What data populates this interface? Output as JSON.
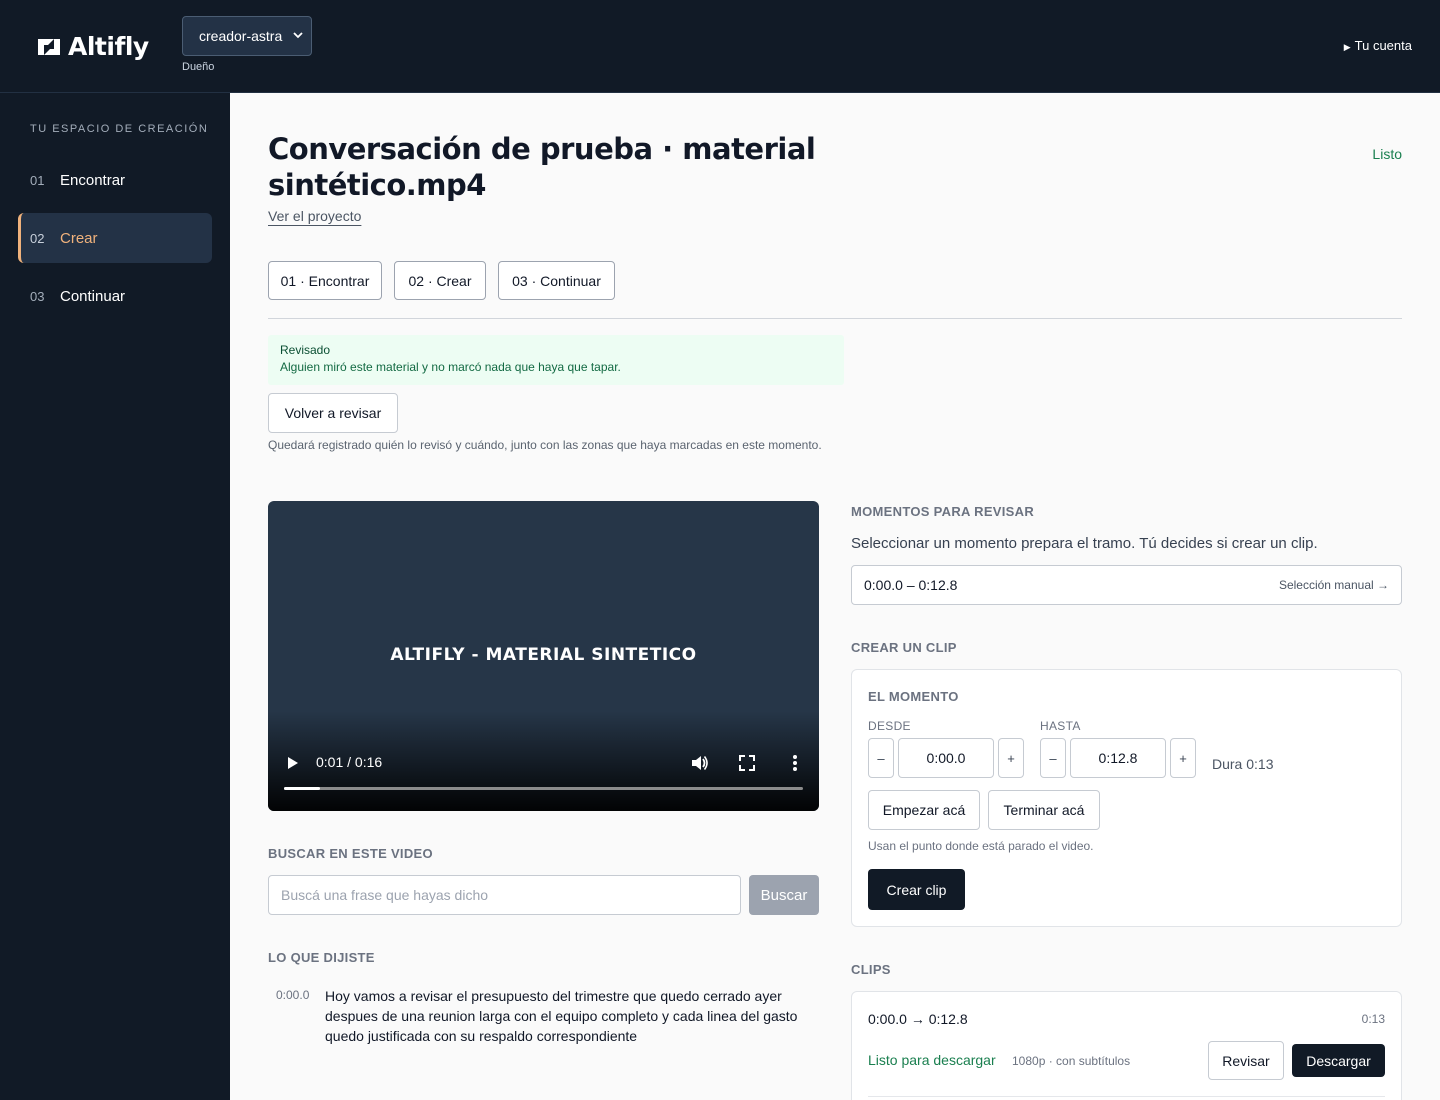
{
  "header": {
    "logo_text": "Altifly",
    "workspace": "creador-astra",
    "role": "Dueño",
    "account": "Tu cuenta"
  },
  "sidebar": {
    "title": "TU ESPACIO DE CREACIÓN",
    "items": [
      {
        "num": "01",
        "label": "Encontrar"
      },
      {
        "num": "02",
        "label": "Crear",
        "active": true
      },
      {
        "num": "03",
        "label": "Continuar"
      }
    ]
  },
  "project": {
    "title": "Conversación de prueba · material sintético.mp4",
    "link": "Ver el proyecto",
    "status": "Listo"
  },
  "steps": [
    "01 · Encontrar",
    "02 · Crear",
    "03 · Continuar"
  ],
  "review": {
    "title": "Revisado",
    "detail": "Alguien miró este material y no marcó nada que haya que tapar.",
    "button": "Volver a revisar",
    "note": "Quedará registrado quién lo revisó y cuándo, junto con las zonas que haya marcadas en este momento."
  },
  "video": {
    "caption": "ALTIFLY - MATERIAL SINTETICO",
    "time": "0:01 / 0:16",
    "progress_fraction": 0.07
  },
  "search": {
    "heading": "BUSCAR EN ESTE VIDEO",
    "placeholder": "Buscá una frase que hayas dicho",
    "button": "Buscar"
  },
  "transcript": {
    "heading": "LO QUE DIJISTE",
    "items": [
      {
        "time": "0:00.0",
        "text": "Hoy vamos a revisar el presupuesto del trimestre que quedo cerrado ayer despues de una reunion larga con el equipo completo y cada linea del gasto quedo justificada con su respaldo correspondiente"
      }
    ]
  },
  "moments": {
    "heading": "MOMENTOS PARA REVISAR",
    "note": "Seleccionar un momento prepara el tramo. Tú decides si crear un clip.",
    "range": "0:00.0 – 0:12.8",
    "manual": "Selección manual →"
  },
  "create": {
    "heading": "CREAR UN CLIP",
    "moment_heading": "EL MOMENTO",
    "from_label": "DESDE",
    "to_label": "HASTA",
    "from_value": "0:00.0",
    "to_value": "0:12.8",
    "minus": "–",
    "plus": "+",
    "duration": "Dura 0:13",
    "start_here": "Empezar acá",
    "end_here": "Terminar acá",
    "here_note": "Usan el punto donde está parado el video.",
    "create_button": "Crear clip"
  },
  "clips": {
    "heading": "CLIPS",
    "items": [
      {
        "range": "0:00.0 → 0:12.8",
        "length": "0:13",
        "status": "Listo para descargar",
        "meta": "1080p · con subtítulos",
        "review": "Revisar",
        "download": "Descargar"
      }
    ]
  },
  "colors": {
    "dark": "#111a26",
    "accent": "#f0b27c",
    "success": "#1a7f4f"
  }
}
